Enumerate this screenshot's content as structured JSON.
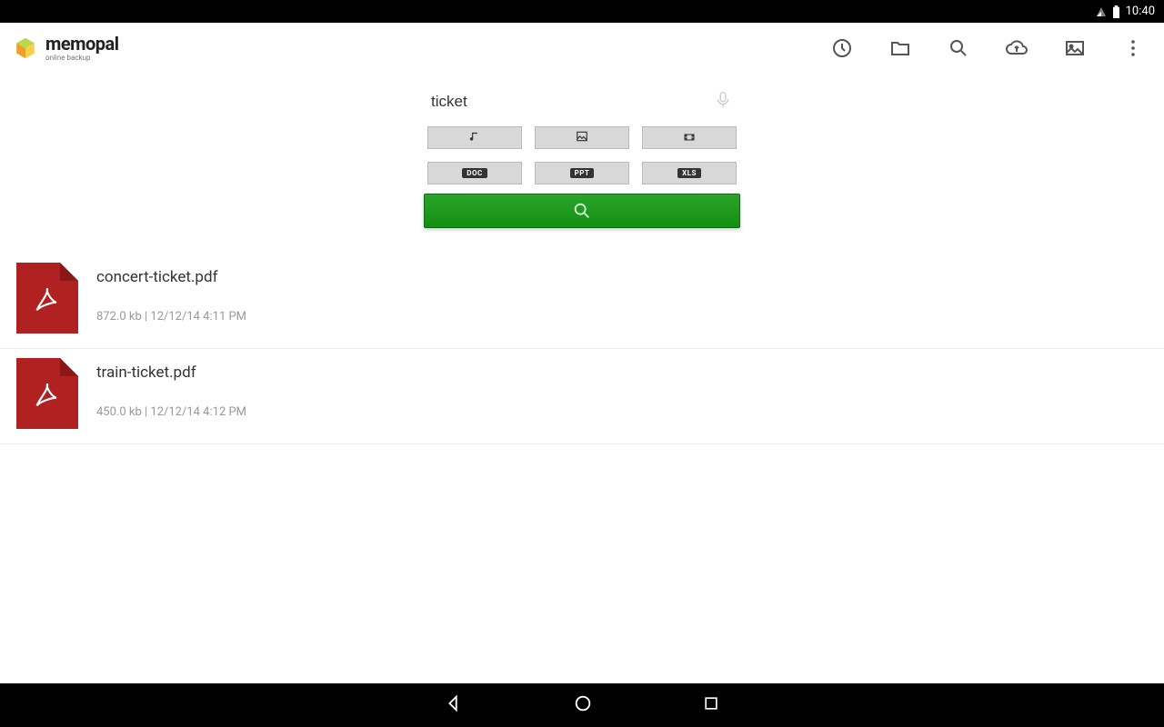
{
  "status": {
    "time": "10:40"
  },
  "brand": {
    "name": "memopal",
    "tagline": "online backup"
  },
  "search": {
    "value": "ticket"
  },
  "filters": {
    "music": "music",
    "image": "image",
    "video": "video",
    "doc": "DOC",
    "ppt": "PPT",
    "xls": "XLS"
  },
  "results": [
    {
      "name": "concert-ticket.pdf",
      "meta": "872.0 kb | 12/12/14 4:11 PM"
    },
    {
      "name": "train-ticket.pdf",
      "meta": "450.0 kb | 12/12/14 4:12 PM"
    }
  ]
}
